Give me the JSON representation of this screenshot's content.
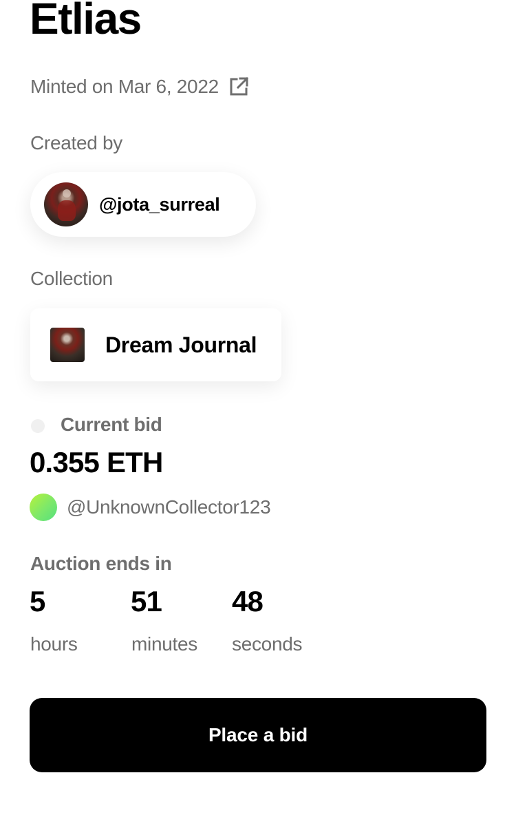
{
  "nft": {
    "title": "Etlias",
    "minted_text": "Minted on Mar 6, 2022",
    "minted_icon": "external-link-icon"
  },
  "creator": {
    "label": "Created by",
    "handle": "@jota_surreal"
  },
  "collection": {
    "label": "Collection",
    "name": "Dream Journal"
  },
  "bid": {
    "label": "Current bid",
    "amount": "0.355 ETH",
    "bidder": "@UnknownCollector123"
  },
  "auction": {
    "label": "Auction ends in",
    "hours_value": "5",
    "hours_unit": "hours",
    "minutes_value": "51",
    "minutes_unit": "minutes",
    "seconds_value": "48",
    "seconds_unit": "seconds"
  },
  "actions": {
    "place_bid_label": "Place a bid"
  },
  "colors": {
    "primary_text": "#000000",
    "secondary_text": "#6e6e6e",
    "button_bg": "#000000",
    "button_text": "#ffffff",
    "bidder_avatar_gradient_start": "#b7f23a",
    "bidder_avatar_gradient_end": "#55e07e"
  }
}
